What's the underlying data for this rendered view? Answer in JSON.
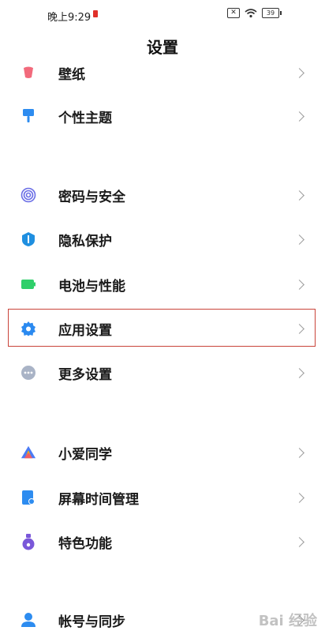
{
  "status_bar": {
    "time": "晚上9:29",
    "battery": "39"
  },
  "header": {
    "title": "设置"
  },
  "items": [
    {
      "label": "壁纸",
      "icon": "wallpaper-icon",
      "color": "#f26a7c"
    },
    {
      "label": "个性主题",
      "icon": "theme-brush-icon",
      "color": "#2d8cf0"
    },
    {
      "label": "密码与安全",
      "icon": "fingerprint-icon",
      "color": "#6a6ee6"
    },
    {
      "label": "隐私保护",
      "icon": "privacy-shield-icon",
      "color": "#1f8fe0"
    },
    {
      "label": "电池与性能",
      "icon": "battery-icon",
      "color": "#2fcf6a"
    },
    {
      "label": "应用设置",
      "icon": "gear-icon",
      "color": "#2b8af0"
    },
    {
      "label": "更多设置",
      "icon": "more-dots-icon",
      "color": "#a9b3c6"
    },
    {
      "label": "小爱同学",
      "icon": "xiaoai-icon",
      "color": "#4b7bf5"
    },
    {
      "label": "屏幕时间管理",
      "icon": "screen-time-icon",
      "color": "#2d8cf0"
    },
    {
      "label": "特色功能",
      "icon": "special-features-icon",
      "color": "#7a57d9"
    },
    {
      "label": "帐号与同步",
      "icon": "account-icon",
      "color": "#2d8cf0"
    }
  ],
  "watermark": "Bai 经验"
}
